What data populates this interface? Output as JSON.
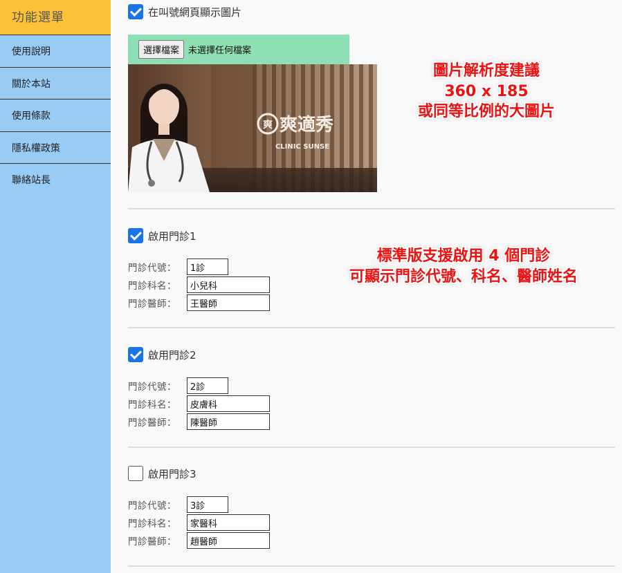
{
  "sidebar": {
    "header": "功能選單",
    "items": [
      {
        "label": "使用說明"
      },
      {
        "label": "關於本站"
      },
      {
        "label": "使用條款"
      },
      {
        "label": "隱私權政策"
      },
      {
        "label": "聯絡站長"
      }
    ]
  },
  "image_section": {
    "show_image_label": "在叫號網頁顯示圖片",
    "show_image_checked": true,
    "file_button": "選擇檔案",
    "file_status": "未選擇任何檔案",
    "preview_logo_text": "爽適秀",
    "preview_logo_sub": "CLINIC SUNSE"
  },
  "annotations": {
    "image_hint_lines": [
      "圖片解析度建議",
      "360 x 185",
      "或同等比例的大圖片"
    ],
    "clinic_hint_lines": [
      "標準版支援啟用 4 個門診",
      "可顯示門診代號、科名、醫師姓名"
    ]
  },
  "field_labels": {
    "code": "門診代號：",
    "dept": "門診科名：",
    "doctor": "門診醫師："
  },
  "clinics": [
    {
      "label": "啟用門診1",
      "enabled": true,
      "code": "1診",
      "dept": "小兒科",
      "doctor": "王醫師"
    },
    {
      "label": "啟用門診2",
      "enabled": true,
      "code": "2診",
      "dept": "皮膚科",
      "doctor": "陳醫師"
    },
    {
      "label": "啟用門診3",
      "enabled": false,
      "code": "3診",
      "dept": "家醫科",
      "doctor": "趙醫師"
    }
  ],
  "colors": {
    "sidebar_bg": "#99ccf5",
    "sidebar_header_bg": "#fcc237",
    "file_bar_bg": "#8ee0b4",
    "checkbox_checked": "#1b73e8",
    "annotation_red": "#ee1111"
  }
}
